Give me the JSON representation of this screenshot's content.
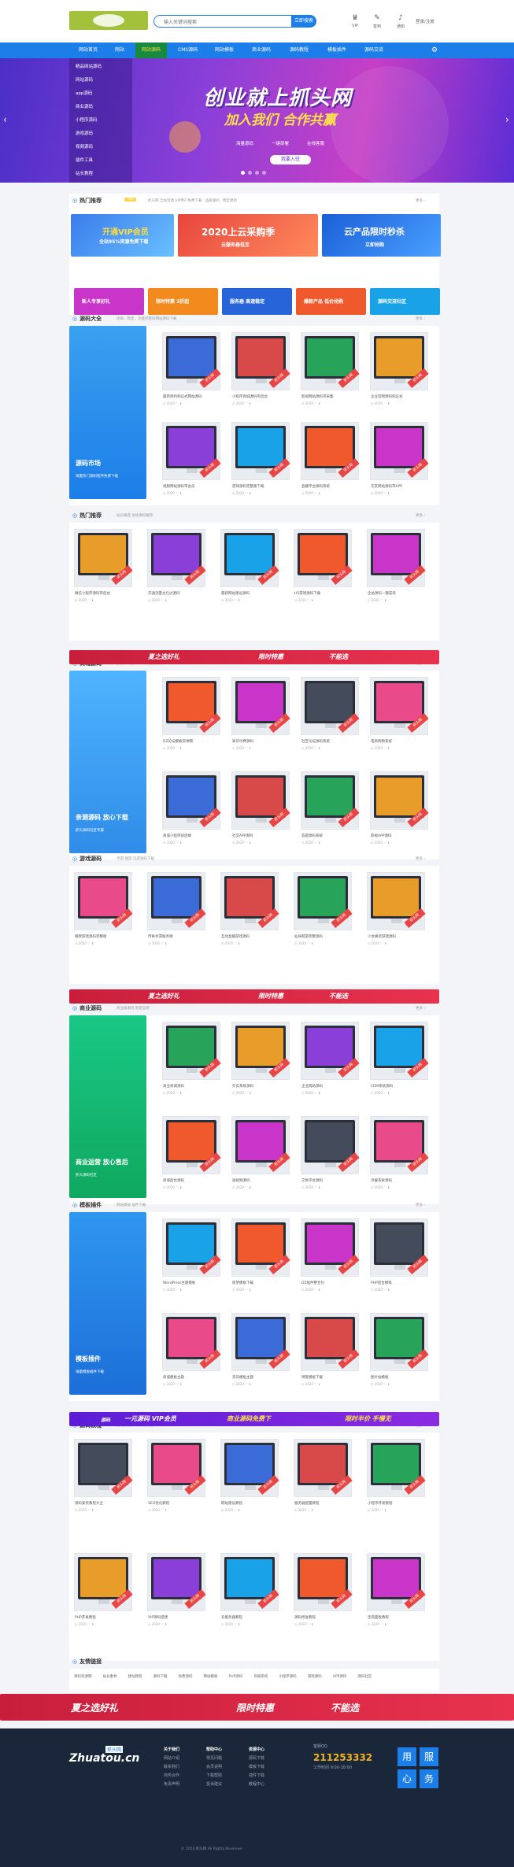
{
  "header": {
    "search_placeholder": "输入关键词搜索",
    "search_btn": "立即搜索",
    "icons": [
      {
        "name": "vip-icon",
        "label": "VIP"
      },
      {
        "name": "tag-icon",
        "label": "签到"
      },
      {
        "name": "bell-icon",
        "label": "通知"
      }
    ],
    "login": "登录/注册"
  },
  "nav": [
    "网站首页",
    "网站",
    "网站源码",
    "CMS源码",
    "网站模板",
    "商业源码",
    "源码教程",
    "模板插件",
    "源码交流"
  ],
  "sidebar": [
    "精品网站源码",
    "网站源码",
    "app源码",
    "商业源码",
    "小程序源码",
    "游戏源码",
    "视频源码",
    "插件工具",
    "站长教程"
  ],
  "banner": {
    "title": "创业就上抓头网",
    "subtitle": "加入我们 合作共赢",
    "features": [
      "海量源码",
      "一键部署",
      "在线客服"
    ],
    "button": "我要入驻"
  },
  "hot": {
    "title": "热门推荐",
    "badge": "hot",
    "text": "抓头网 全站资源 VIP用户免费下载 · 品质源码 · 稳定更新"
  },
  "promos": [
    {
      "l1": "开通VIP会员",
      "l2": "全站95%资源免费下载",
      "color": "#3a7bec"
    },
    {
      "l1": "2020上云采购季",
      "l2": "云服务器低至",
      "color": "#e8453d"
    },
    {
      "l1": "云产品限时秒杀",
      "l2": "立即抢购",
      "color": "#1a5fd8"
    }
  ],
  "small_promos": [
    {
      "t": "新人专享好礼",
      "c": "#c935c9"
    },
    {
      "t": "限时特惠 3折起",
      "c": "#f28a1e"
    },
    {
      "t": "服务器 高速稳定",
      "c": "#2763d9"
    },
    {
      "t": "爆款产品 低价抢购",
      "c": "#f0592c"
    },
    {
      "t": "源码交流社区",
      "c": "#1aa2e8"
    }
  ],
  "sections": [
    {
      "title": "源码大全",
      "desc": "优质、稳定、功能完善的网站源码下载",
      "side": "源码市场",
      "side2": "海量热门源码程序免费下载",
      "items": [
        "最新简约响应式网站源码",
        "小程序商城源码带后台",
        "影视网站源码带采集",
        "企业官网源码响应式",
        "视频网站源码带会员",
        "游戏源码完整版下载",
        "直播平台源码系统",
        "交友网站源码带APP"
      ]
    },
    {
      "title": "热门推荐",
      "desc": "站长精选 优质源码推荐",
      "items": [
        "微信小程序源码带后台",
        "开通流量主包过源码",
        "最新网站建设源码",
        "H5游戏源码下载",
        "全站源码一键安装"
      ]
    },
    {
      "title": "商城源码",
      "desc": "多用户商城 B2B2C 系统源码",
      "side": "亲测源码 放心下载",
      "side2": "抓头源码社区专属",
      "items": [
        "DZ论坛模板资源网",
        "知识付费源码",
        "社区论坛源码系统",
        "电商购物系统",
        "商城小程序前后端",
        "社交APP源码",
        "答题源码系统",
        "影视APP源码"
      ]
    },
    {
      "title": "游戏源码",
      "desc": "手游 端游 页游源码下载",
      "items": [
        "棋牌游戏源码完整版",
        "传奇手游服务端",
        "互动直播游戏源码",
        "仙侠网游完整源码",
        "少女换装游戏源码"
      ]
    },
    {
      "title": "商业源码",
      "desc": "商业级源码 稳定运营",
      "side": "商业运营 放心售后",
      "side2": "抓头源码社区",
      "items": [
        "商业商城源码",
        "外卖系统源码",
        "企业网站源码",
        "CRM系统源码",
        "商城后台源码",
        "短视频源码",
        "交易平台源码",
        "点餐系统源码"
      ]
    },
    {
      "title": "模板插件",
      "desc": "网站模板 插件下载",
      "side": "模板插件",
      "side2": "海量模板插件下载",
      "items": [
        "WordPress主题模板",
        "织梦模板下载",
        "DZ插件整合包",
        "PHP后台模板",
        "商城模板主题",
        "资讯模板主题",
        "博客模板下载",
        "图片站模板"
      ]
    },
    {
      "title": "源码教程",
      "desc": "建站教程 源码安装教程",
      "items": [
        "源码安装教程大全",
        "SEO优化教程",
        "网站建设教程",
        "服务器配置教程",
        "小程序开发教程",
        "PHP开发教程",
        "VIP源码搭建",
        "云服务器教程",
        "源码修复教程",
        "宝塔面板教程"
      ]
    }
  ],
  "stripe": {
    "t1": "夏之选好礼",
    "t2": "限时特惠",
    "t3": "不能选"
  },
  "vip_stripe": {
    "t1": "源码",
    "t2": "一元源码 VIP会员",
    "t3": "商业源码免费下",
    "t4": "限时半价 手慢无"
  },
  "links": {
    "title": "友情链接",
    "items": [
      "源码资源网",
      "站长素材",
      "建站教程",
      "源码下载",
      "免费源码",
      "网站模板",
      "PHP源码",
      "商城系统",
      "小程序源码",
      "游戏源码",
      "APP源码",
      "源码社区"
    ]
  },
  "footer": {
    "logo": "Zhuatou.cn",
    "site": "抓头网",
    "cols": [
      {
        "h": "关于我们",
        "l": [
          "网站介绍",
          "联系我们",
          "商务合作",
          "免责声明"
        ]
      },
      {
        "h": "帮助中心",
        "l": [
          "常见问题",
          "会员说明",
          "下载帮助",
          "投诉建议"
        ]
      },
      {
        "h": "资源中心",
        "l": [
          "源码下载",
          "模板下载",
          "插件下载",
          "教程中心"
        ]
      }
    ],
    "qq_label": "客服QQ",
    "qq": "211253332",
    "time": "工作时间 9:00-18:00",
    "blocks": [
      "用",
      "服",
      "心",
      "务"
    ],
    "copyright": "© 2020 抓头网 All Rights Reserved"
  }
}
